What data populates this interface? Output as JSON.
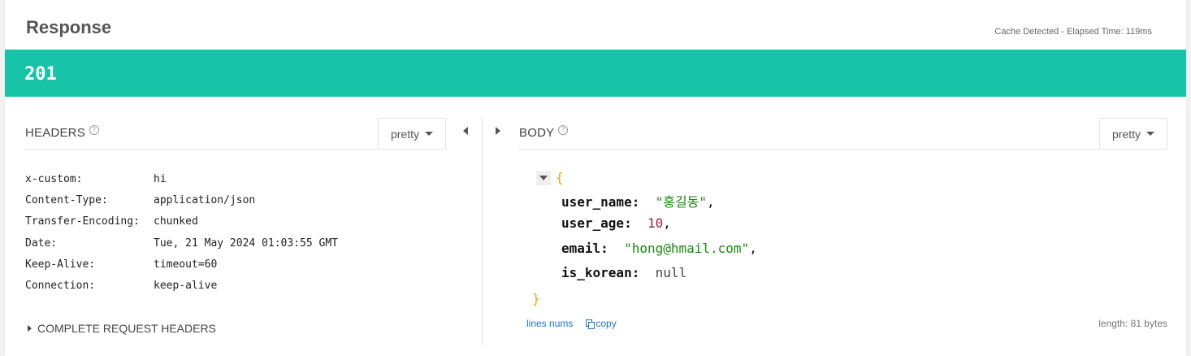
{
  "response": {
    "title": "Response",
    "meta": "Cache Detected - Elapsed Time: 119ms",
    "status_code": "201",
    "colors": {
      "status_bar": "#18c4a7"
    }
  },
  "headers_panel": {
    "title": "HEADERS",
    "view_mode": "pretty",
    "rows": [
      {
        "key": "x-custom:",
        "value": "hi"
      },
      {
        "key": "Content-Type:",
        "value": "application/json"
      },
      {
        "key": "Transfer-Encoding:",
        "value": "chunked"
      },
      {
        "key": "Date:",
        "value": "Tue, 21 May 2024 01:03:55 GMT"
      },
      {
        "key": "Keep-Alive:",
        "value": "timeout=60"
      },
      {
        "key": "Connection:",
        "value": "keep-alive"
      }
    ],
    "complete_request_label": "COMPLETE REQUEST HEADERS"
  },
  "body_panel": {
    "title": "BODY",
    "view_mode": "pretty",
    "json": {
      "open_brace": "{",
      "close_brace": "}",
      "lines": [
        {
          "key": "user_name:",
          "value": "\"홍길동\"",
          "type": "string",
          "trail": ","
        },
        {
          "key": "user_age:",
          "value": "10",
          "type": "number",
          "trail": ","
        },
        {
          "key": "email:",
          "value": "\"hong@hmail.com\"",
          "type": "string",
          "trail": ","
        },
        {
          "key": "is_korean:",
          "value": "null",
          "type": "null",
          "trail": ""
        }
      ]
    },
    "lines_nums_label": "lines nums",
    "copy_label": "copy",
    "length_label": "length: 81 bytes"
  }
}
